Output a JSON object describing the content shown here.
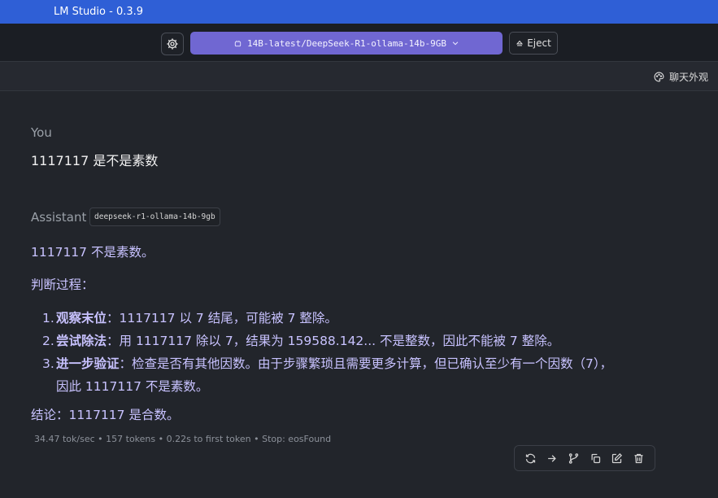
{
  "window": {
    "title": "LM Studio - 0.3.9"
  },
  "toolbar": {
    "model_name": "14B-latest/DeepSeek-R1-ollama-14b-9GB",
    "eject_label": "Eject"
  },
  "subbar": {
    "appearance_label": "聊天外观"
  },
  "chat": {
    "user": {
      "sender": "You",
      "message": "1117117 是不是素数"
    },
    "assistant": {
      "sender": "Assistant",
      "model_tag": "deepseek-r1-ollama-14b-9gb",
      "answer": "1117117 不是素数。",
      "process_title": "判断过程：",
      "steps": [
        {
          "num": "1.",
          "title": "观察末位",
          "text": "：1117117 以 7 结尾，可能被 7 整除。"
        },
        {
          "num": "2.",
          "title": "尝试除法",
          "text": "：用 1117117 除以 7，结果为 159588.142... 不是整数，因此不能被 7 整除。"
        },
        {
          "num": "3.",
          "title": "进一步验证",
          "text": "：检查是否有其他因数。由于步骤繁琐且需要更多计算，但已确认至少有一个因数（7），",
          "text2": "因此 1117117 不是素数。"
        }
      ],
      "conclusion": "结论：1117117 是合数。",
      "stats": "34.47 tok/sec • 157 tokens • 0.22s to first token • Stop: eosFound"
    }
  },
  "colors": {
    "titlebar": "#2f5fd6",
    "model_select": "#7067d2",
    "assistant_text": "#c8c2ff",
    "background": "#22252b"
  },
  "icons": {
    "settings": "gear-icon",
    "model": "model-chip-icon",
    "dropdown": "chevron-down-icon",
    "eject": "eject-icon",
    "appearance": "palette-icon",
    "regenerate": "refresh-icon",
    "continue": "arrow-right-icon",
    "branch": "branch-icon",
    "copy": "copy-icon",
    "edit": "edit-icon",
    "delete": "trash-icon"
  }
}
